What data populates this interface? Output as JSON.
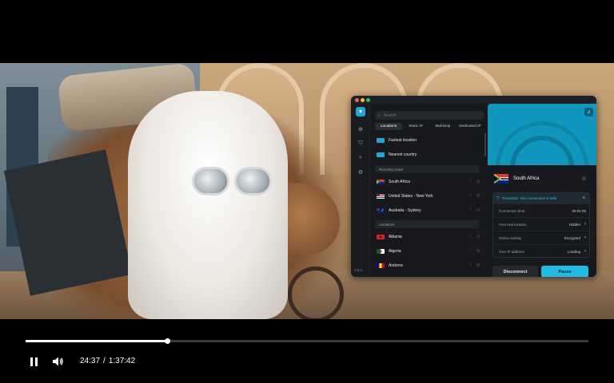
{
  "player": {
    "current_time": "24:37",
    "separator": "/",
    "duration": "1:37:42",
    "progress_fraction": 0.251
  },
  "vpn": {
    "version": "4.8.2",
    "search_placeholder": "Search",
    "tabs": [
      "Locations",
      "Static IP",
      "MultiHop",
      "Dedicated IP"
    ],
    "quick": [
      {
        "label": "Fastest location"
      },
      {
        "label": "Nearest country"
      }
    ],
    "recent_header": "Recently Used",
    "recent": [
      {
        "label": "South Africa"
      },
      {
        "label": "United States - New York"
      },
      {
        "label": "Australia - Sydney"
      }
    ],
    "locations_header": "Locations",
    "locations": [
      {
        "label": "Albania"
      },
      {
        "label": "Algeria"
      },
      {
        "label": "Andorra"
      }
    ],
    "connected_country": "South Africa",
    "status_text": "Protected. Your connection is safe",
    "status_rows": [
      {
        "label": "Connection time",
        "value": "00:01:05"
      },
      {
        "label": "Your real location",
        "value": "Hidden"
      },
      {
        "label": "Online activity",
        "value": "Encrypted"
      },
      {
        "label": "Your IP address",
        "value": "Loading"
      }
    ],
    "disconnect_label": "Disconnect",
    "pause_label": "Pause",
    "accent_color": "#1fbde4"
  }
}
